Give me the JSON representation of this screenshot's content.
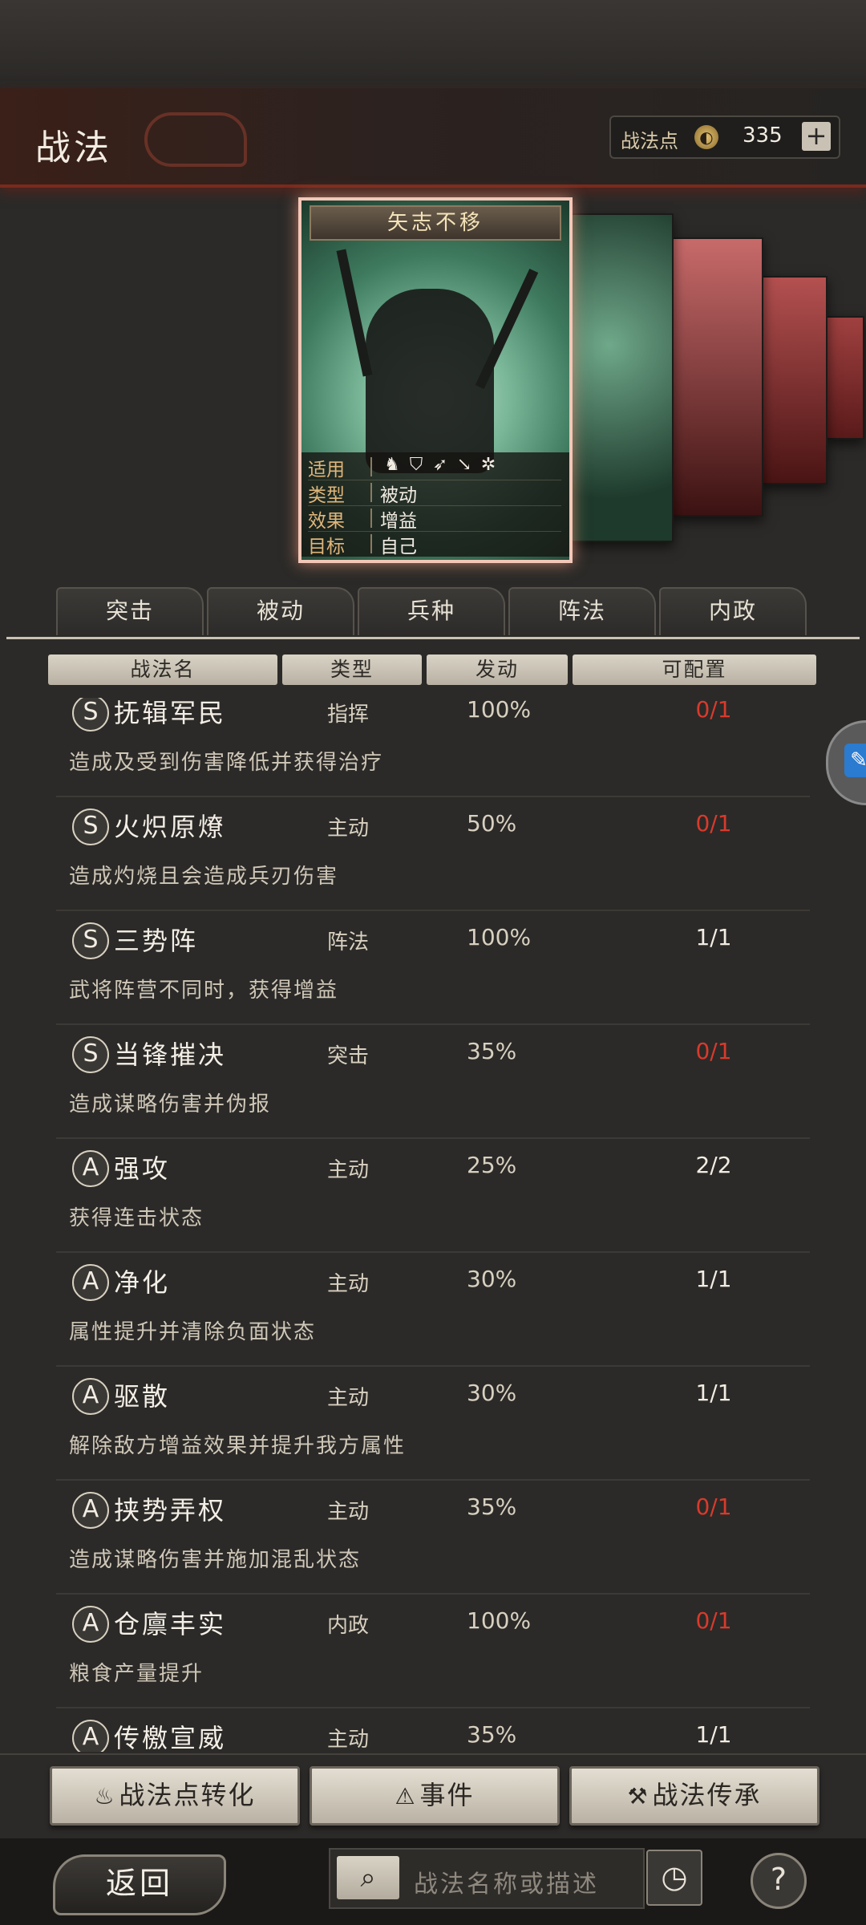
{
  "header": {
    "title": "战法",
    "points_label": "战法点",
    "points_value": "335",
    "add_symbol": "+"
  },
  "card": {
    "title": "矢志不移",
    "rows": [
      {
        "label": "适用",
        "value": ""
      },
      {
        "label": "类型",
        "value": "被动"
      },
      {
        "label": "效果",
        "value": "增益"
      },
      {
        "label": "目标",
        "value": "自己"
      }
    ],
    "troop_icons": [
      "cavalry-icon",
      "shield-icon",
      "bow-icon",
      "spear-icon",
      "wheel-icon"
    ]
  },
  "tabs": [
    "突击",
    "被动",
    "兵种",
    "阵法",
    "内政"
  ],
  "columns": [
    "战法名",
    "类型",
    "发动",
    "可配置"
  ],
  "skills": [
    {
      "grade": "S",
      "name": "抚辑军民",
      "type": "指挥",
      "rate": "100%",
      "avail": "0/1",
      "avail_color": "#d83a2c",
      "desc": "造成及受到伤害降低并获得治疗"
    },
    {
      "grade": "S",
      "name": "火炽原燎",
      "type": "主动",
      "rate": "50%",
      "avail": "0/1",
      "avail_color": "#d83a2c",
      "desc": "造成灼烧且会造成兵刃伤害"
    },
    {
      "grade": "S",
      "name": "三势阵",
      "type": "阵法",
      "rate": "100%",
      "avail": "1/1",
      "avail_color": "#f2ece2",
      "desc": "武将阵营不同时，获得增益"
    },
    {
      "grade": "S",
      "name": "当锋摧决",
      "type": "突击",
      "rate": "35%",
      "avail": "0/1",
      "avail_color": "#d83a2c",
      "desc": "造成谋略伤害并伪报"
    },
    {
      "grade": "A",
      "name": "强攻",
      "type": "主动",
      "rate": "25%",
      "avail": "2/2",
      "avail_color": "#f2ece2",
      "desc": "获得连击状态"
    },
    {
      "grade": "A",
      "name": "净化",
      "type": "主动",
      "rate": "30%",
      "avail": "1/1",
      "avail_color": "#f2ece2",
      "desc": "属性提升并清除负面状态"
    },
    {
      "grade": "A",
      "name": "驱散",
      "type": "主动",
      "rate": "30%",
      "avail": "1/1",
      "avail_color": "#f2ece2",
      "desc": "解除敌方增益效果并提升我方属性"
    },
    {
      "grade": "A",
      "name": "挟势弄权",
      "type": "主动",
      "rate": "35%",
      "avail": "0/1",
      "avail_color": "#d83a2c",
      "desc": "造成谋略伤害并施加混乱状态"
    },
    {
      "grade": "A",
      "name": "仓廪丰实",
      "type": "内政",
      "rate": "100%",
      "avail": "0/1",
      "avail_color": "#d83a2c",
      "desc": "粮食产量提升"
    },
    {
      "grade": "A",
      "name": "传檄宣威",
      "type": "主动",
      "rate": "35%",
      "avail": "1/1",
      "avail_color": "#f2ece2",
      "desc": ""
    }
  ],
  "actions": {
    "convert": "战法点转化",
    "events": "事件",
    "inherit": "战法传承"
  },
  "footer": {
    "back": "返回",
    "search_placeholder": "战法名称或描述"
  }
}
